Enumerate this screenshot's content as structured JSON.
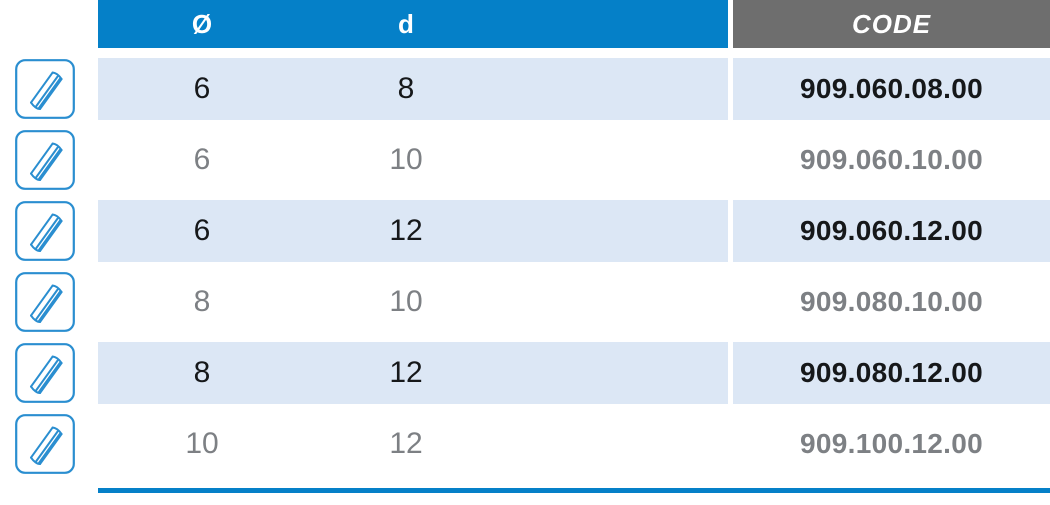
{
  "table": {
    "header": {
      "diameter_label": "Ø",
      "d_label": "d",
      "code_label": "CODE"
    },
    "colors": {
      "header_blue": "#0580c8",
      "header_gray": "#6e6e6e",
      "row_stripe": "#dce7f5",
      "row_plain": "#ffffff",
      "text_dark": "#16181a",
      "text_gray": "#7d8084",
      "icon_blue": "#2a8ed0",
      "bottom_rule": "#0580c8"
    },
    "icon_name": "grooved-cylinder-icon",
    "rows": [
      {
        "icon": "grooved-cylinder-icon",
        "diameter": "6",
        "d": "8",
        "code": "909.060.08.00"
      },
      {
        "icon": "grooved-cylinder-icon",
        "diameter": "6",
        "d": "10",
        "code": "909.060.10.00"
      },
      {
        "icon": "grooved-cylinder-icon",
        "diameter": "6",
        "d": "12",
        "code": "909.060.12.00"
      },
      {
        "icon": "grooved-cylinder-icon",
        "diameter": "8",
        "d": "10",
        "code": "909.080.10.00"
      },
      {
        "icon": "grooved-cylinder-icon",
        "diameter": "8",
        "d": "12",
        "code": "909.080.12.00"
      },
      {
        "icon": "grooved-cylinder-icon",
        "diameter": "10",
        "d": "12",
        "code": "909.100.12.00"
      }
    ]
  }
}
